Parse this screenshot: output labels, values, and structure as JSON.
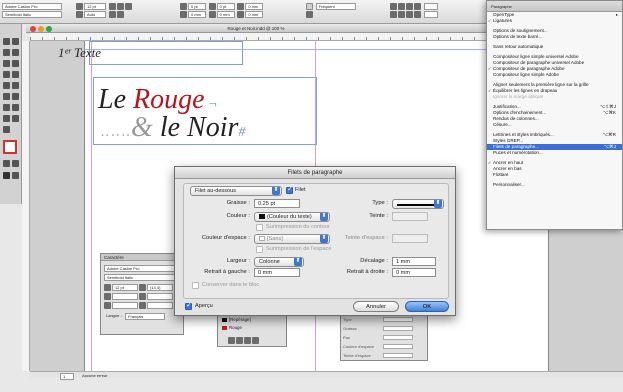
{
  "control_bar": {
    "font_family": "Adobe Caslon Pro",
    "font_style": "Semibold Italic",
    "leading": "Auto",
    "size": "12 pt",
    "small_fields": [
      "0 pt",
      "0 pt",
      "0 mm",
      "0 mm",
      "0 mm",
      "0 mm"
    ],
    "paragraph_style": "Fréquent"
  },
  "document": {
    "title": "Rouge et Noir.indd @ 100 %",
    "zoom": "100 %"
  },
  "canvas": {
    "heading_small": "1ᵉʳ Texte",
    "line1_black": "Le ",
    "line1_red": "Rouge",
    "line1_tail": " ¬",
    "line2_dots": "‥‥‥",
    "line2_amp": "&",
    "line2_black": " le ",
    "line2_italic": "Noir",
    "line2_pilcrow": "#"
  },
  "status_bar": {
    "page": "1",
    "status": "Aucune erreur"
  },
  "panel_menu": {
    "header": "Paragraphe",
    "items": [
      {
        "label": "OpenType",
        "submenu": true
      },
      {
        "label": "Ligatures",
        "checked": true
      },
      {
        "sep": true
      },
      {
        "label": "Options de soulignement..."
      },
      {
        "label": "Options de texte barré..."
      },
      {
        "sep": true
      },
      {
        "label": "Sans retour automatique"
      },
      {
        "sep": true
      },
      {
        "label": "Compositeur ligne simple universel Adobe"
      },
      {
        "label": "Compositeur de paragraphe universel Adobe"
      },
      {
        "label": "Compositeur de paragraphe Adobe",
        "checked": true
      },
      {
        "label": "Compositeur ligne simple Adobe"
      },
      {
        "sep": true
      },
      {
        "label": "Aligner seulement la première ligne sur la grille"
      },
      {
        "label": "Équilibrer les lignes en drapeau",
        "checked": true
      },
      {
        "label": "Ignorer la marge optique",
        "disabled": true
      },
      {
        "sep": true
      },
      {
        "label": "Justification...",
        "shortcut": "⌥⇧⌘J"
      },
      {
        "label": "Options d'enchainement...",
        "shortcut": "⌥⌘K"
      },
      {
        "label": "Rendus de colonnes..."
      },
      {
        "label": "Césure..."
      },
      {
        "sep": true
      },
      {
        "label": "Lettrines et styles imbriqués...",
        "shortcut": "⌥⌘R"
      },
      {
        "label": "Styles GREP..."
      },
      {
        "label": "Filets de paragraphe...",
        "shortcut": "⌥⌘J",
        "selected": true
      },
      {
        "label": "Puces et numérotation..."
      },
      {
        "sep": true
      },
      {
        "label": "Ancrer en haut",
        "checked": true
      },
      {
        "label": "Ancrer en bas"
      },
      {
        "label": "Flottant"
      },
      {
        "sep": true
      },
      {
        "label": "Personnaliser..."
      }
    ]
  },
  "dialog": {
    "title": "Filets de paragraphe",
    "rule_position": "Filet au-dessous",
    "rule_on_label": "Filet",
    "weight_label": "Graisse :",
    "weight_value": "0,25 pt",
    "type_label": "Type :",
    "color_label": "Couleur :",
    "color_value": "(Couleur du texte)",
    "tint_label": "Teinte :",
    "overprint_stroke": "Surimpression du contour",
    "gap_color_label": "Couleur d'espace :",
    "gap_color_value": "[Sans]",
    "gap_tint_label": "Teinte d'espace :",
    "overprint_gap": "Surimpression de l'espace",
    "width_label": "Largeur :",
    "width_value": "Colonne",
    "offset_label": "Décalage :",
    "offset_value": "1 mm",
    "left_indent_label": "Retrait à gauche :",
    "left_indent_value": "0 mm",
    "right_indent_label": "Retrait à droite :",
    "right_indent_value": "0 mm",
    "keep_in_frame": "Conserver dans le bloc",
    "preview_label": "Aperçu",
    "cancel_label": "Annuler",
    "ok_label": "OK"
  },
  "character_panel": {
    "header": "Caractère",
    "font": "Adobe Caslon Pro",
    "style": "Semibold Italic",
    "size": "12 pt",
    "leading": "(14,4)",
    "language": "Français"
  },
  "swatches_panel": {
    "rows": [
      "[Repérage]",
      "Rouge"
    ]
  },
  "paragraph_panel": {
    "rows": [
      "Type",
      "Graisse",
      "Pas",
      "Couleur d'espace",
      "Teinte d'espace"
    ]
  },
  "colors": {
    "accent": "#3b6fd6",
    "red_text": "#b5151c"
  }
}
